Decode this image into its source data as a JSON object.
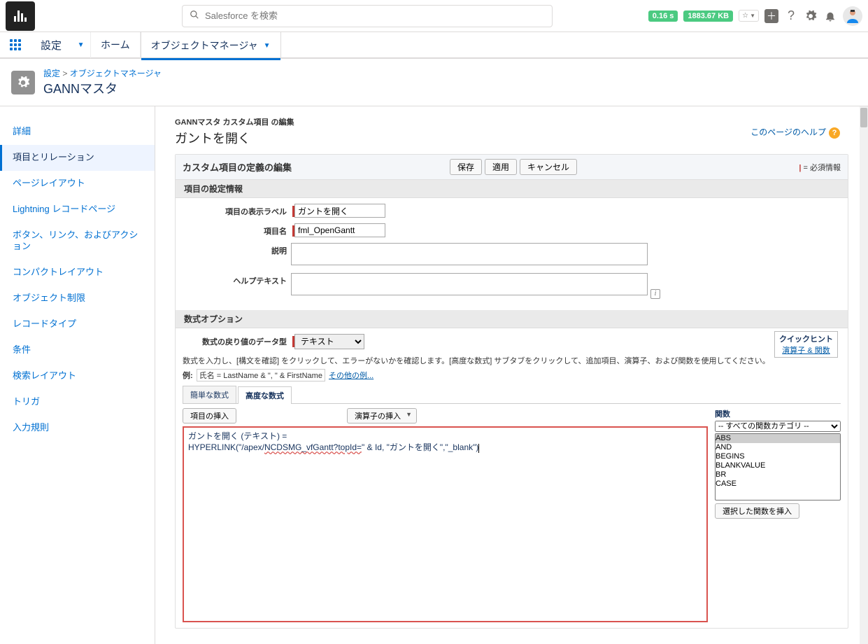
{
  "header": {
    "search_placeholder": "Salesforce を検索",
    "perf_time": "0.16 s",
    "perf_size": "1883.67 KB"
  },
  "nav": {
    "setup": "設定",
    "home": "ホーム",
    "obj_mgr": "オブジェクトマネージャ"
  },
  "breadcrumb": {
    "a": "設定",
    "b": "オブジェクトマネージャ",
    "title": "GANNマスタ"
  },
  "sidebar": {
    "items": [
      "詳細",
      "項目とリレーション",
      "ページレイアウト",
      "Lightning レコードページ",
      "ボタン、リンク、およびアクション",
      "コンパクトレイアウト",
      "オブジェクト制限",
      "レコードタイプ",
      "条件",
      "検索レイアウト",
      "トリガ",
      "入力規則"
    ]
  },
  "main": {
    "crumb": "GANNマスタ カスタム項目 の編集",
    "title": "ガントを開く",
    "help": "このページのヘルプ",
    "panel_title": "カスタム項目の定義の編集",
    "btn_save": "保存",
    "btn_apply": "適用",
    "btn_cancel": "キャンセル",
    "required_note": "= 必須情報",
    "section1": "項目の設定情報",
    "lbl_display": "項目の表示ラベル",
    "val_display": "ガントを開く",
    "lbl_name": "項目名",
    "val_name": "fml_OpenGantt",
    "lbl_desc": "説明",
    "lbl_help": "ヘルプテキスト",
    "section2": "数式オプション",
    "lbl_return": "数式の戻り値のデータ型",
    "val_return": "テキスト",
    "quick_tip_t": "クイックヒント",
    "quick_tip_l": "演算子 & 関数",
    "hint": "数式を入力し、[構文を確認] をクリックして、エラーがないかを確認します。[高度な数式] サブタブをクリックして、追加項目、演算子、および関数を使用してください。",
    "example_lbl": "例:",
    "example_val": "氏名 = LastName & \", \" & FirstName",
    "example_more": "その他の例...",
    "tab_simple": "簡単な数式",
    "tab_adv": "高度な数式",
    "btn_insert_field": "項目の挿入",
    "btn_insert_op": "演算子の挿入",
    "formula_line1": "ガントを開く (テキスト) =",
    "formula_line2a": "HYPERLINK(\"/apex/",
    "formula_line2b": "NCDSMG_vfGantt?topId=",
    "formula_line2c": "\" & Id, \"ガントを開く\",\"_blank\")",
    "func_header": "関数",
    "func_cat": "-- すべての関数カテゴリ --",
    "funcs": [
      "ABS",
      "AND",
      "BEGINS",
      "BLANKVALUE",
      "BR",
      "CASE"
    ],
    "btn_insert_func": "選択した関数を挿入"
  }
}
